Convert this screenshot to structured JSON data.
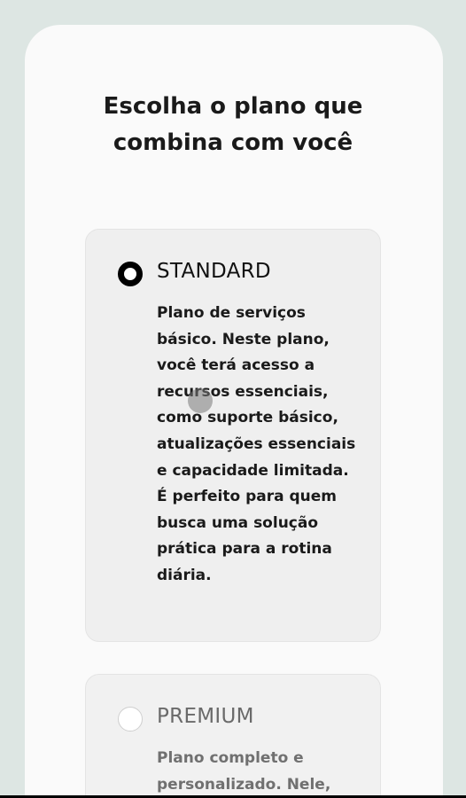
{
  "page": {
    "title_line1": "Escolha o plano que",
    "title_line2": "combina com você"
  },
  "plans": [
    {
      "name": "STANDARD",
      "selected": true,
      "description": "Plano de serviços básico. Neste plano, você terá acesso a recursos essenciais, como suporte básico, atualizações essenciais e capacidade limitada. É perfeito para quem busca uma solução prática para a rotina diária."
    },
    {
      "name": "PREMIUM",
      "selected": false,
      "description": "Plano completo e personalizado. Nele,"
    }
  ],
  "colors": {
    "background": "#dde6e3",
    "card": "#fafafa",
    "plan_card": "#efefef",
    "radio_checked": "#000000",
    "text_primary": "#1a1a1a",
    "text_muted": "#707070"
  }
}
